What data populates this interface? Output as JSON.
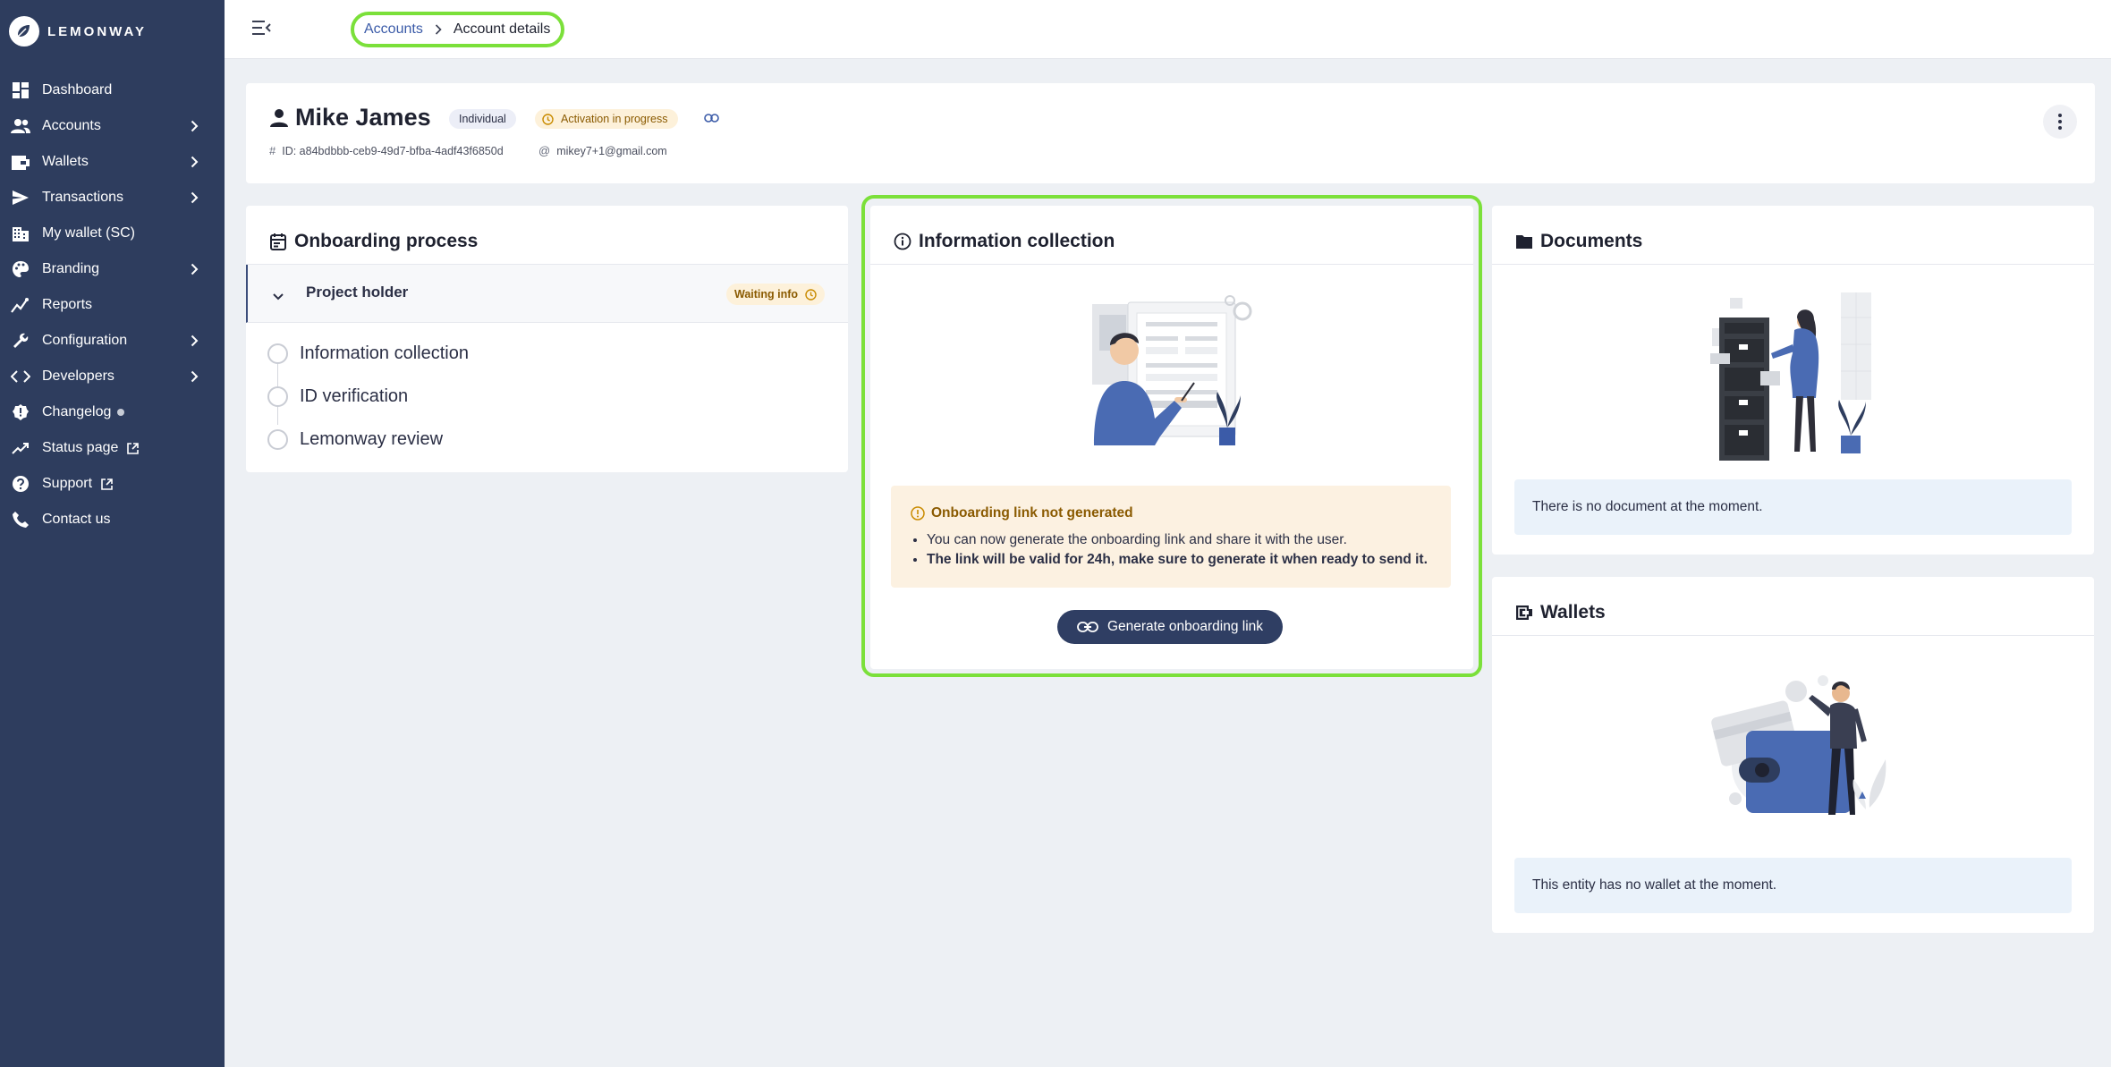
{
  "brand": {
    "name": "LEMONWAY"
  },
  "sidebar": {
    "items": [
      {
        "label": "Dashboard",
        "icon": "dashboard-icon",
        "chevron": false
      },
      {
        "label": "Accounts",
        "icon": "accounts-icon",
        "chevron": true
      },
      {
        "label": "Wallets",
        "icon": "wallet-icon",
        "chevron": true
      },
      {
        "label": "Transactions",
        "icon": "send-icon",
        "chevron": true
      },
      {
        "label": "My wallet (SC)",
        "icon": "building-icon",
        "chevron": false
      },
      {
        "label": "Branding",
        "icon": "palette-icon",
        "chevron": true
      },
      {
        "label": "Reports",
        "icon": "reports-icon",
        "chevron": false
      },
      {
        "label": "Configuration",
        "icon": "wrench-icon",
        "chevron": true
      },
      {
        "label": "Developers",
        "icon": "code-icon",
        "chevron": true
      },
      {
        "label": "Changelog",
        "icon": "changelog-icon",
        "chevron": false
      },
      {
        "label": "Status page",
        "icon": "trending-icon",
        "chevron": false
      },
      {
        "label": "Support",
        "icon": "help-icon",
        "chevron": false
      },
      {
        "label": "Contact us",
        "icon": "phone-icon",
        "chevron": false
      }
    ]
  },
  "breadcrumb": {
    "parent": "Accounts",
    "current": "Account details"
  },
  "account": {
    "name": "Mike James",
    "type_badge": "Individual",
    "status_badge": "Activation in progress",
    "id_text": "ID: a84bdbbb-ceb9-49d7-bfba-4adf43f6850d",
    "email": "mikey7+1@gmail.com"
  },
  "onboarding": {
    "title": "Onboarding process",
    "section_label": "Project holder",
    "section_status": "Waiting info",
    "steps": [
      "Information collection",
      "ID verification",
      "Lemonway review"
    ]
  },
  "info_collection": {
    "title": "Information collection",
    "alert_title": "Onboarding link not generated",
    "alert_line1": "You can now generate the onboarding link and share it with the user.",
    "alert_line2": "The link will be valid for 24h, make sure to generate it when ready to send it.",
    "button_label": "Generate onboarding link"
  },
  "documents": {
    "title": "Documents",
    "empty_text": "There is no document at the moment."
  },
  "wallets": {
    "title": "Wallets",
    "empty_text": "This entity has no wallet at the moment."
  },
  "colors": {
    "sidebar_bg": "#2e3d5e",
    "accent_dark": "#2f3e63",
    "highlight_green": "#7be03a",
    "status_amber": "#8a5a00",
    "status_amber_bg": "#fdf1da",
    "info_bg": "#eaf2fa"
  }
}
